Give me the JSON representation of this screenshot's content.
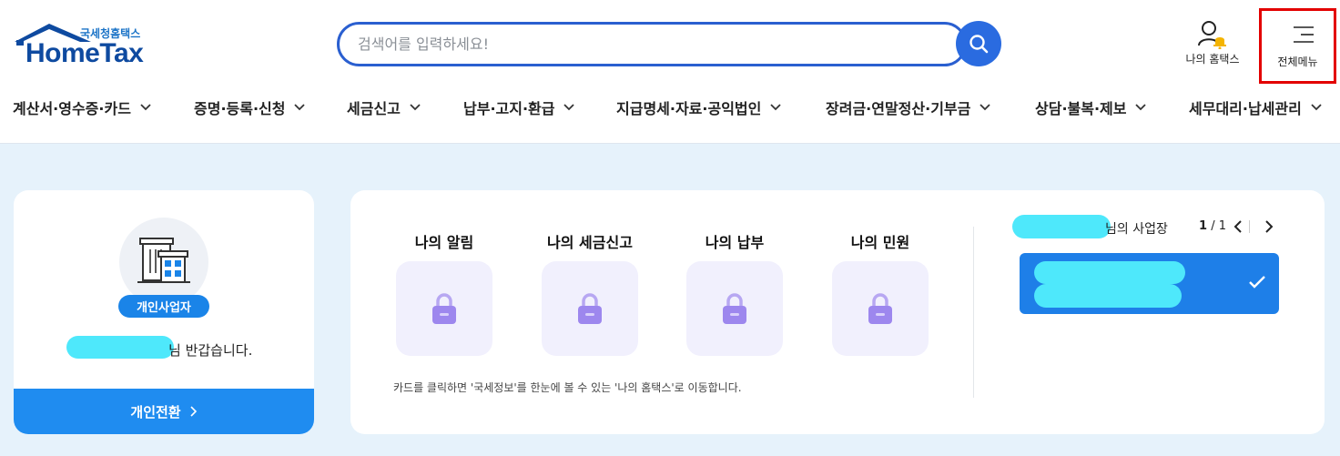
{
  "brand": {
    "sub": "국세청홈택스",
    "name": "HomeTax",
    "colors": {
      "primary": "#2a6be0",
      "navy": "#0e4aa0",
      "highlight": "#e30000",
      "redaction": "#4ee8fb"
    }
  },
  "search": {
    "placeholder": "검색어를 입력하세요!",
    "value": "",
    "icon": "search-icon"
  },
  "header_actions": {
    "my_hometax": "나의 홈택스",
    "all_menu": "전체메뉴"
  },
  "nav": [
    {
      "label": "계산서·영수증·카드"
    },
    {
      "label": "증명·등록·신청"
    },
    {
      "label": "세금신고"
    },
    {
      "label": "납부·고지·환급"
    },
    {
      "label": "지급명세·자료·공익법인"
    },
    {
      "label": "장려금·연말정산·기부금"
    },
    {
      "label": "상담·불복·제보"
    },
    {
      "label": "세무대리·납세관리"
    }
  ],
  "profile": {
    "badge": "개인사업자",
    "greeting_suffix": "님 반갑습니다.",
    "switch_label": "개인전환"
  },
  "tiles": [
    {
      "title": "나의 알림",
      "icon": "lock-icon"
    },
    {
      "title": "나의 세금신고",
      "icon": "lock-icon"
    },
    {
      "title": "나의 납부",
      "icon": "lock-icon"
    },
    {
      "title": "나의 민원",
      "icon": "lock-icon"
    }
  ],
  "hint": "카드를 클릭하면 '국세정보'를 한눈에 볼 수 있는 '나의 홈택스'로 이동합니다.",
  "business": {
    "label_suffix": "님의 사업장",
    "page_current": "1",
    "page_total": "/ 1"
  }
}
